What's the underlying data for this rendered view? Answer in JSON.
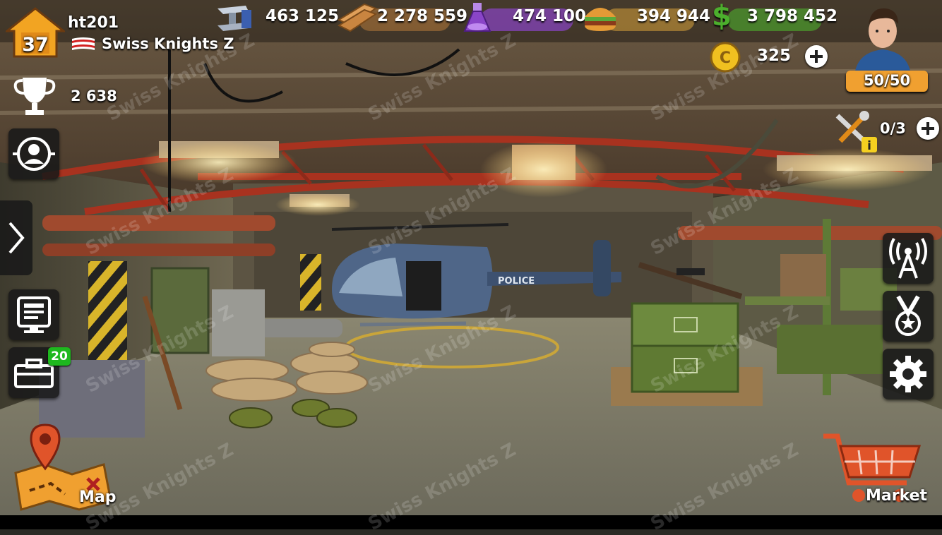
{
  "player": {
    "level": "37",
    "name": "ht201",
    "team": "Swiss Knights Z",
    "trophies": "2 638"
  },
  "resources": {
    "steel": "463 125",
    "wood": "2 278 559",
    "chemicals": "474 100",
    "food": "394 944",
    "cash": "3 798 452",
    "coins": "325"
  },
  "energy": "50/50",
  "builders": "0/3",
  "garage_badge": "20",
  "nav": {
    "map_label": "Map",
    "market_label": "Market"
  },
  "scene": {
    "helicopter_text": "POLICE"
  },
  "watermark": "Swiss Knights Z",
  "colors": {
    "steel": "#3b5fb0",
    "wood": "#b77a3a",
    "chemicals": "#8a45c8",
    "food": "#d9a23b",
    "cash": "#4caf2d",
    "accent": "#f0a030",
    "badge": "#1eb81e"
  }
}
